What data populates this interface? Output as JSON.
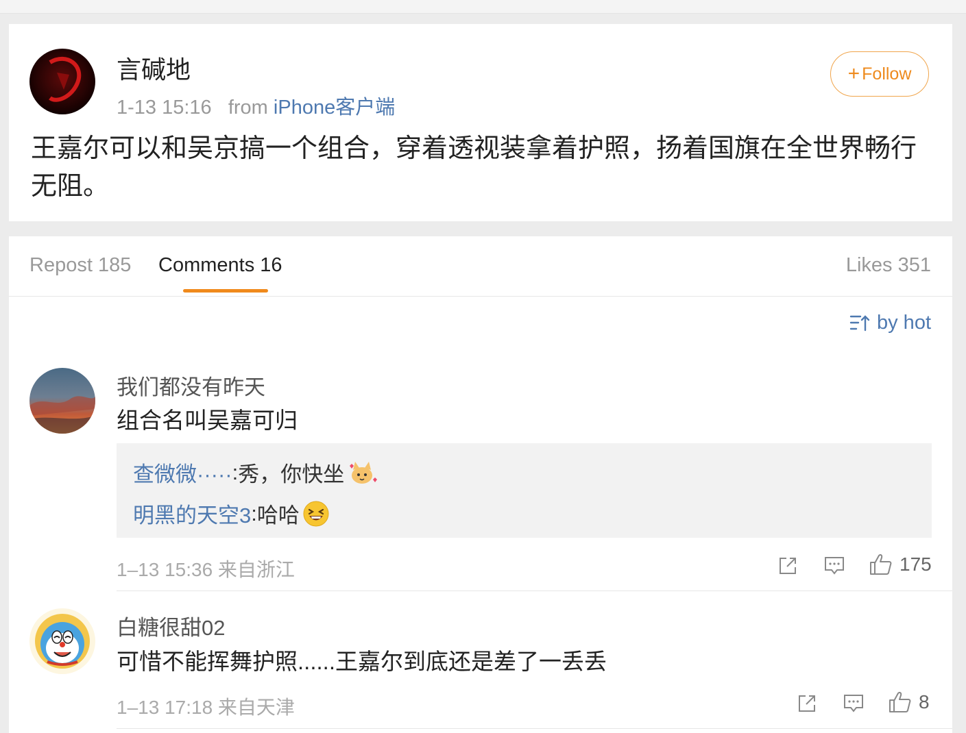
{
  "post": {
    "author": "言碱地",
    "time": "1-13 15:16",
    "from_prefix": "from",
    "source": "iPhone客户端",
    "follow_label": "Follow",
    "text": "王嘉尔可以和吴京搞一个组合，穿着透视装拿着护照，扬着国旗在全世界畅行无阻。"
  },
  "tabs": {
    "repost": "Repost 185",
    "comments": "Comments 16",
    "likes": "Likes 351"
  },
  "sort_label": "by hot",
  "comments": [
    {
      "name": "我们都没有昨天",
      "text": "组合名叫吴嘉可归",
      "replies": [
        {
          "name": "查微微·····",
          "sep": ":",
          "text": " 秀，你快坐",
          "emoji": "cat-hearts-emoji"
        },
        {
          "name": "明黑的天空3",
          "sep": ":",
          "text": " 哈哈",
          "emoji": "laughing-emoji"
        }
      ],
      "time": "1–13 15:36 来自浙江",
      "likes": "175"
    },
    {
      "name": "白糖很甜02",
      "text": "可惜不能挥舞护照......王嘉尔到底还是差了一丢丢",
      "time": "1–13 17:18 来自天津",
      "likes": "8"
    }
  ],
  "icons": [
    "share-icon",
    "comment-icon",
    "thumbs-up-icon",
    "sort-icon",
    "plus-icon"
  ],
  "colors": {
    "accent": "#f08a1c",
    "link": "#4e79b0"
  }
}
